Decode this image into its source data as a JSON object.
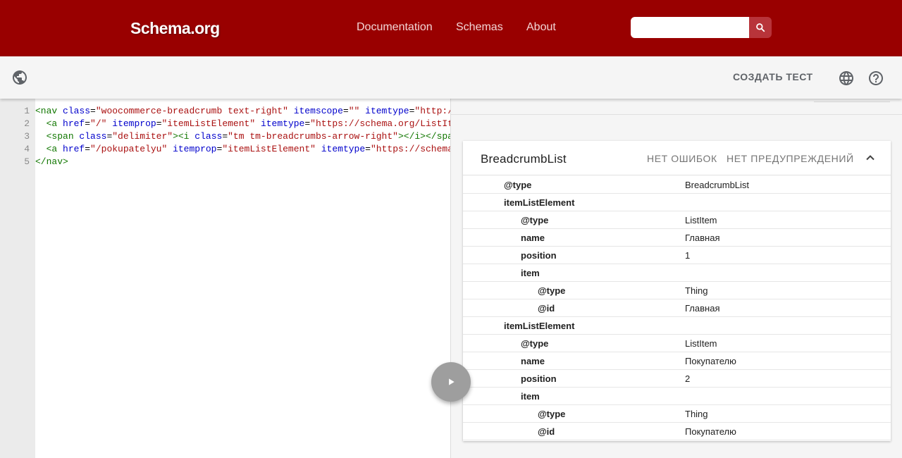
{
  "header": {
    "logo": "Schema.org",
    "nav": [
      "Documentation",
      "Schemas",
      "About"
    ],
    "search_placeholder": ""
  },
  "toolbar": {
    "new_test_label": "СОЗДАТЬ ТЕСТ"
  },
  "editor": {
    "line_numbers": [
      "1",
      "2",
      "3",
      "4",
      "5"
    ],
    "lines": [
      [
        [
          "tag",
          "<nav "
        ],
        [
          "attr",
          "class"
        ],
        [
          "plain",
          "="
        ],
        [
          "val",
          "\"woocommerce-breadcrumb text-right\""
        ],
        [
          "plain",
          " "
        ],
        [
          "attr",
          "itemscope"
        ],
        [
          "plain",
          "="
        ],
        [
          "val",
          "\"\""
        ],
        [
          "plain",
          " "
        ],
        [
          "attr",
          "itemtype"
        ],
        [
          "plain",
          "="
        ],
        [
          "val",
          "\"http://schema.org/BreadcrumbList\""
        ],
        [
          "tag",
          ">"
        ]
      ],
      [
        [
          "plain",
          "  "
        ],
        [
          "tag",
          "<a "
        ],
        [
          "attr",
          "href"
        ],
        [
          "plain",
          "="
        ],
        [
          "val",
          "\"/\""
        ],
        [
          "plain",
          " "
        ],
        [
          "attr",
          "itemprop"
        ],
        [
          "plain",
          "="
        ],
        [
          "val",
          "\"itemListElement\""
        ],
        [
          "plain",
          " "
        ],
        [
          "attr",
          "itemtype"
        ],
        [
          "plain",
          "="
        ],
        [
          "val",
          "\"https://schema.org/ListItem\""
        ],
        [
          "tag",
          ">"
        ]
      ],
      [
        [
          "plain",
          "  "
        ],
        [
          "tag",
          "<span "
        ],
        [
          "attr",
          "class"
        ],
        [
          "plain",
          "="
        ],
        [
          "val",
          "\"delimiter\""
        ],
        [
          "tag",
          "><i "
        ],
        [
          "attr",
          "class"
        ],
        [
          "plain",
          "="
        ],
        [
          "val",
          "\"tm tm-breadcrumbs-arrow-right\""
        ],
        [
          "tag",
          "></i></span>"
        ]
      ],
      [
        [
          "plain",
          "  "
        ],
        [
          "tag",
          "<a "
        ],
        [
          "attr",
          "href"
        ],
        [
          "plain",
          "="
        ],
        [
          "val",
          "\"/pokupatelyu\""
        ],
        [
          "plain",
          " "
        ],
        [
          "attr",
          "itemprop"
        ],
        [
          "plain",
          "="
        ],
        [
          "val",
          "\"itemListElement\""
        ],
        [
          "plain",
          " "
        ],
        [
          "attr",
          "itemtype"
        ],
        [
          "plain",
          "="
        ],
        [
          "val",
          "\"https://schema.org/ListItem\""
        ],
        [
          "tag",
          ">"
        ]
      ],
      [
        [
          "tag",
          "</nav>"
        ]
      ]
    ]
  },
  "results": {
    "card_title": "BreadcrumbList",
    "errors_label": "НЕТ ОШИБОК",
    "warnings_label": "НЕТ ПРЕДУПРЕЖДЕНИЙ",
    "rows": [
      {
        "level": 0,
        "key": "@type",
        "value": "BreadcrumbList"
      },
      {
        "level": 0,
        "key": "itemListElement",
        "value": ""
      },
      {
        "level": 1,
        "key": "@type",
        "value": "ListItem"
      },
      {
        "level": 1,
        "key": "name",
        "value": "Главная"
      },
      {
        "level": 1,
        "key": "position",
        "value": "1"
      },
      {
        "level": 1,
        "key": "item",
        "value": ""
      },
      {
        "level": 2,
        "key": "@type",
        "value": "Thing"
      },
      {
        "level": 2,
        "key": "@id",
        "value": "Главная"
      },
      {
        "level": 0,
        "key": "itemListElement",
        "value": ""
      },
      {
        "level": 1,
        "key": "@type",
        "value": "ListItem"
      },
      {
        "level": 1,
        "key": "name",
        "value": "Покупателю"
      },
      {
        "level": 1,
        "key": "position",
        "value": "2"
      },
      {
        "level": 1,
        "key": "item",
        "value": ""
      },
      {
        "level": 2,
        "key": "@type",
        "value": "Thing"
      },
      {
        "level": 2,
        "key": "@id",
        "value": "Покупателю"
      }
    ]
  },
  "icons": {
    "globe_left": "public-globe-icon",
    "language": "language-icon",
    "help": "help-icon",
    "search": "search-icon",
    "run": "play-icon",
    "collapse": "chevron-up-icon"
  },
  "colors": {
    "brand": "#990000",
    "search_button": "#b8343a"
  }
}
